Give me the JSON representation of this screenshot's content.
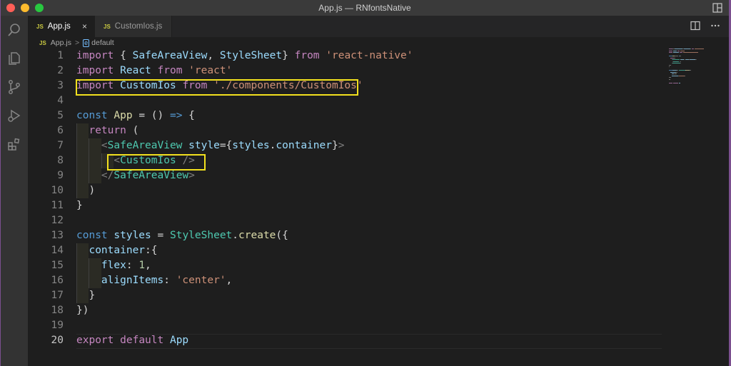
{
  "window": {
    "title": "App.js — RNfontsNative"
  },
  "tabs": [
    {
      "badge": "JS",
      "label": "App.js",
      "active": true,
      "close": "×"
    },
    {
      "badge": "JS",
      "label": "CustomIos.js",
      "active": false
    }
  ],
  "breadcrumb": {
    "badge": "JS",
    "file": "App.js",
    "sep": ">",
    "symbol_badge": "e",
    "symbol": "default"
  },
  "icons": {
    "activity": [
      "search-icon",
      "explorer-icon",
      "source-control-icon",
      "run-debug-icon",
      "extensions-icon"
    ],
    "title_right": "layout-icon",
    "tab_actions": [
      "split-editor-icon",
      "more-actions-icon"
    ]
  },
  "colors": {
    "keyword": "#c586c0",
    "declaration": "#569cd6",
    "variable": "#9cdcfe",
    "class": "#4ec9b0",
    "string": "#ce9178",
    "function": "#dcdcaa",
    "number": "#b5cea8",
    "highlight_box": "#f2e01e"
  },
  "editor": {
    "current_line": 20,
    "line_numbers": [
      "1",
      "2",
      "3",
      "4",
      "5",
      "6",
      "7",
      "8",
      "9",
      "10",
      "11",
      "12",
      "13",
      "14",
      "15",
      "16",
      "17",
      "18",
      "19",
      "20"
    ],
    "lines": [
      [
        [
          "kw",
          "import"
        ],
        [
          "pun",
          " { "
        ],
        [
          "id",
          "SafeAreaView"
        ],
        [
          "pun",
          ", "
        ],
        [
          "id",
          "StyleSheet"
        ],
        [
          "pun",
          "} "
        ],
        [
          "kw",
          "from"
        ],
        [
          "pun",
          " "
        ],
        [
          "str",
          "'react-native'"
        ]
      ],
      [
        [
          "kw",
          "import"
        ],
        [
          "pun",
          " "
        ],
        [
          "id",
          "React"
        ],
        [
          "pun",
          " "
        ],
        [
          "kw",
          "from"
        ],
        [
          "pun",
          " "
        ],
        [
          "str",
          "'react'"
        ]
      ],
      [
        [
          "kw",
          "import"
        ],
        [
          "pun",
          " "
        ],
        [
          "id",
          "CustomIos"
        ],
        [
          "pun",
          " "
        ],
        [
          "kw",
          "from"
        ],
        [
          "pun",
          " "
        ],
        [
          "str",
          "'./components/CustomIos'"
        ]
      ],
      [],
      [
        [
          "kd",
          "const"
        ],
        [
          "pun",
          " "
        ],
        [
          "fn",
          "App"
        ],
        [
          "pun",
          " = () "
        ],
        [
          "kd",
          "=>"
        ],
        [
          "pun",
          " {"
        ]
      ],
      [
        [
          "pun",
          "  "
        ],
        [
          "kw",
          "return"
        ],
        [
          "pun",
          " ("
        ]
      ],
      [
        [
          "pun",
          "    "
        ],
        [
          "tag",
          "<"
        ],
        [
          "cls",
          "SafeAreaView"
        ],
        [
          "pun",
          " "
        ],
        [
          "id",
          "style"
        ],
        [
          "pun",
          "={"
        ],
        [
          "id",
          "styles"
        ],
        [
          "pun",
          "."
        ],
        [
          "id",
          "container"
        ],
        [
          "pun",
          "}"
        ],
        [
          "tag",
          ">"
        ]
      ],
      [
        [
          "pun",
          "      "
        ],
        [
          "tag",
          "<"
        ],
        [
          "cls",
          "CustomIos"
        ],
        [
          "pun",
          " "
        ],
        [
          "tag",
          "/>"
        ]
      ],
      [
        [
          "pun",
          "    "
        ],
        [
          "tag",
          "</"
        ],
        [
          "cls",
          "SafeAreaView"
        ],
        [
          "tag",
          ">"
        ]
      ],
      [
        [
          "pun",
          "  )"
        ]
      ],
      [
        [
          "pun",
          "}"
        ]
      ],
      [],
      [
        [
          "kd",
          "const"
        ],
        [
          "pun",
          " "
        ],
        [
          "id",
          "styles"
        ],
        [
          "pun",
          " = "
        ],
        [
          "cls",
          "StyleSheet"
        ],
        [
          "pun",
          "."
        ],
        [
          "fn",
          "create"
        ],
        [
          "pun",
          "({"
        ]
      ],
      [
        [
          "pun",
          "  "
        ],
        [
          "id",
          "container"
        ],
        [
          "pun",
          ":{"
        ]
      ],
      [
        [
          "pun",
          "    "
        ],
        [
          "id",
          "flex"
        ],
        [
          "pun",
          ": "
        ],
        [
          "num",
          "1"
        ],
        [
          "pun",
          ","
        ]
      ],
      [
        [
          "pun",
          "    "
        ],
        [
          "id",
          "alignItems"
        ],
        [
          "pun",
          ": "
        ],
        [
          "str",
          "'center'"
        ],
        [
          "pun",
          ","
        ]
      ],
      [
        [
          "pun",
          "  }"
        ]
      ],
      [
        [
          "pun",
          "})"
        ]
      ],
      [],
      [
        [
          "kw",
          "export"
        ],
        [
          "pun",
          " "
        ],
        [
          "kw",
          "default"
        ],
        [
          "pun",
          " "
        ],
        [
          "id",
          "App"
        ]
      ]
    ]
  }
}
